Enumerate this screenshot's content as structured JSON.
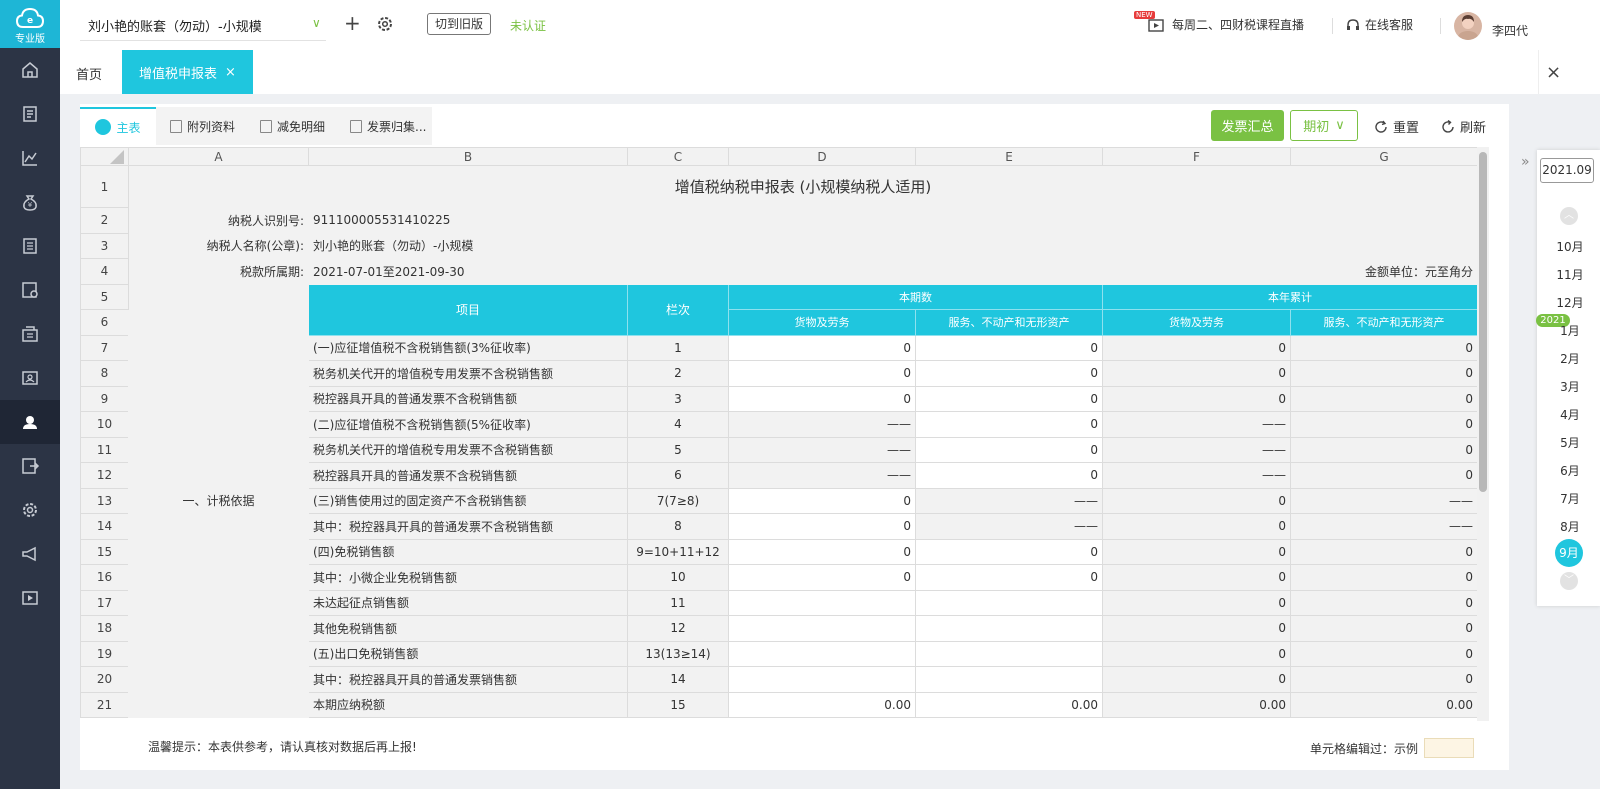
{
  "sidebar": {
    "logo_label": "专业版"
  },
  "topbar": {
    "account": "刘小艳的账套（勿动）-小规模",
    "switch_old": "切到旧版",
    "unverified": "未认证",
    "live_badge": "NEW",
    "live": "每周二、四财税课程直播",
    "service": "在线客服",
    "user": "李四代"
  },
  "tabs": {
    "home": "首页",
    "active": "增值税申报表"
  },
  "subtabs": [
    "主表",
    "附列资料",
    "减免明细",
    "发票归集..."
  ],
  "toolbar": {
    "invoice_summary": "发票汇总",
    "period": "期初",
    "reset": "重置",
    "refresh": "刷新"
  },
  "sheet": {
    "columns": [
      "A",
      "B",
      "C",
      "D",
      "E",
      "F",
      "G"
    ],
    "title": "增值税纳税申报表 (小规模纳税人适用)",
    "taxpayer_id_label": "纳税人识别号:",
    "taxpayer_id": "911100005531410225",
    "taxpayer_name_label": "纳税人名称(公章):",
    "taxpayer_name": "刘小艳的账套（勿动）-小规模",
    "period_label": "税款所属期:",
    "period": "2021-07-01至2021-09-30",
    "unit": "金额单位：元至角分",
    "header": {
      "item": "项目",
      "col": "栏次",
      "current": "本期数",
      "ytd": "本年累计",
      "goods": "货物及劳务",
      "services": "服务、不动产和无形资产",
      "goods2": "货物及劳务",
      "services2": "服务、不动产和无形资产"
    },
    "section": "一、计税依据",
    "row_numbers": [
      "1",
      "2",
      "3",
      "4",
      "5",
      "6",
      "7",
      "8",
      "9",
      "10",
      "11",
      "12",
      "13",
      "14",
      "15",
      "16",
      "17",
      "18",
      "19",
      "20",
      "21"
    ],
    "rows": [
      {
        "item": "(一)应征增值税不含税销售额(3%征收率)",
        "col": "1",
        "d": "0",
        "e": "0",
        "f": "0",
        "g": "0"
      },
      {
        "item": "税务机关代开的增值税专用发票不含税销售额",
        "col": "2",
        "d": "0",
        "e": "0",
        "f": "0",
        "g": "0"
      },
      {
        "item": "税控器具开具的普通发票不含税销售额",
        "col": "3",
        "d": "0",
        "e": "0",
        "f": "0",
        "g": "0"
      },
      {
        "item": "(二)应征增值税不含税销售额(5%征收率)",
        "col": "4",
        "d": "——",
        "e": "0",
        "f": "——",
        "g": "0"
      },
      {
        "item": "税务机关代开的增值税专用发票不含税销售额",
        "col": "5",
        "d": "——",
        "e": "0",
        "f": "——",
        "g": "0"
      },
      {
        "item": "税控器具开具的普通发票不含税销售额",
        "col": "6",
        "d": "——",
        "e": "0",
        "f": "——",
        "g": "0"
      },
      {
        "item": "(三)销售使用过的固定资产不含税销售额",
        "col": "7(7≥8)",
        "d": "0",
        "e": "——",
        "f": "0",
        "g": "——"
      },
      {
        "item": "其中：税控器具开具的普通发票不含税销售额",
        "col": "8",
        "d": "0",
        "e": "——",
        "f": "0",
        "g": "——"
      },
      {
        "item": "(四)免税销售额",
        "col": "9=10+11+12",
        "d": "0",
        "e": "0",
        "f": "0",
        "g": "0"
      },
      {
        "item": "其中：小微企业免税销售额",
        "col": "10",
        "d": "0",
        "e": "0",
        "f": "0",
        "g": "0"
      },
      {
        "item": "未达起征点销售额",
        "col": "11",
        "d": "",
        "e": "",
        "f": "0",
        "g": "0"
      },
      {
        "item": "其他免税销售额",
        "col": "12",
        "d": "",
        "e": "",
        "f": "0",
        "g": "0"
      },
      {
        "item": "(五)出口免税销售额",
        "col": "13(13≥14)",
        "d": "",
        "e": "",
        "f": "0",
        "g": "0"
      },
      {
        "item": "其中：税控器具开具的普通发票销售额",
        "col": "14",
        "d": "",
        "e": "",
        "f": "0",
        "g": "0"
      },
      {
        "item": "本期应纳税额",
        "col": "15",
        "d": "0.00",
        "e": "0.00",
        "f": "0.00",
        "g": "0.00"
      }
    ]
  },
  "footer": {
    "note": "温馨提示：本表供参考，请认真核对数据后再上报!",
    "legend": "单元格编辑过：示例"
  },
  "calendar": {
    "current": "2021.09",
    "months_2020": [
      "10月",
      "11月",
      "12月"
    ],
    "year_badge": "2021",
    "months_2021": [
      "1月",
      "2月",
      "3月",
      "4月",
      "5月",
      "6月",
      "7月",
      "8月"
    ],
    "selected": "9月"
  },
  "colors": {
    "accent": "#1fc6de",
    "green": "#7ac143",
    "sidebar": "#2c3445"
  }
}
